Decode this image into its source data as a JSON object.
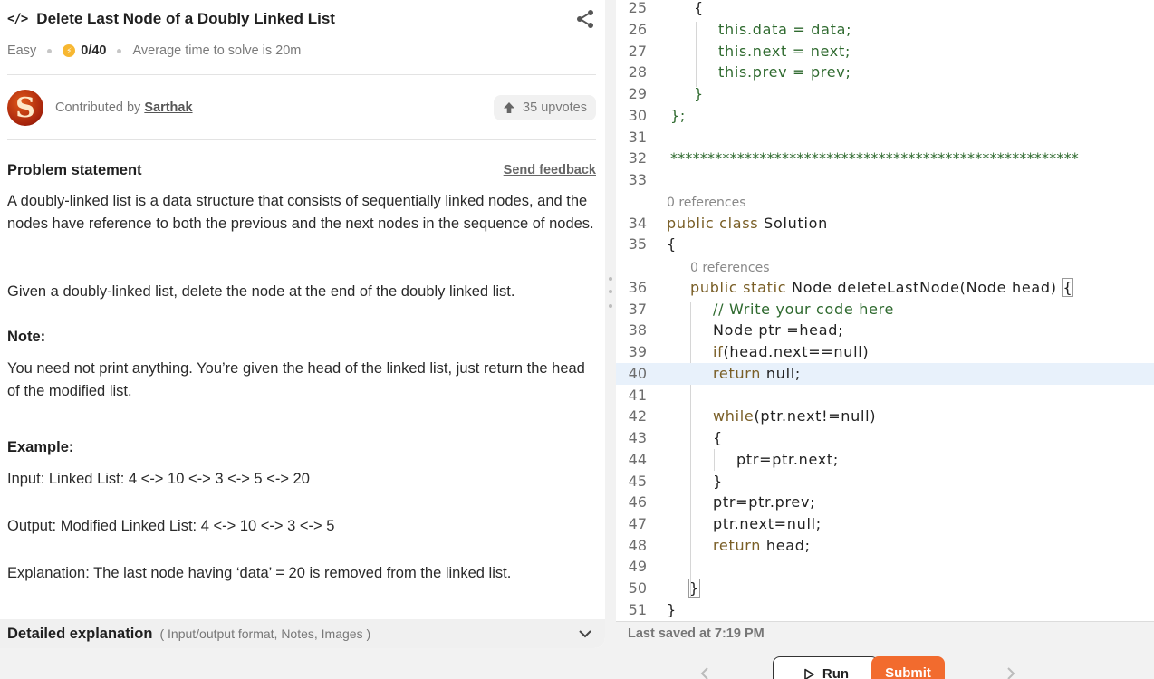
{
  "problem": {
    "title": "Delete Last Node of a Doubly Linked List",
    "difficulty": "Easy",
    "score": "0/40",
    "avg_time": "Average time to solve is 20m",
    "contributed_by_label": "Contributed by",
    "contributor": "Sarthak",
    "avatar_letter": "S",
    "upvotes": "35 upvotes",
    "statement_title": "Problem statement",
    "send_feedback": "Send feedback",
    "paragraphs": [
      "A doubly-linked list is a data structure that consists of sequentially linked nodes, and the nodes have reference to both the previous and the next nodes in the sequence of nodes.",
      "Given a doubly-linked list, delete the node at the end of the doubly linked list."
    ],
    "note_title": "Note:",
    "note_text": "You need not print anything. You’re given the head of the linked list, just return the head of the modified list.",
    "example_title": "Example:",
    "example_input": "Input: Linked List:  4 <-> 10 <-> 3 <-> 5 <-> 20",
    "example_output": "Output: Modified Linked List: 4 <-> 10 <-> 3 <-> 5",
    "example_explanation": "Explanation: The last node having ‘data’ = 20 is removed from the linked list.",
    "detailed_title": "Detailed explanation",
    "detailed_sub": "( Input/output format, Notes, Images )"
  },
  "editor": {
    "line_numbers": [
      "25",
      "26",
      "27",
      "28",
      "29",
      "30",
      "31",
      "32",
      "33",
      "34",
      "35",
      "36",
      "37",
      "38",
      "39",
      "40",
      "41",
      "42",
      "43",
      "44",
      "45",
      "46",
      "47",
      "48",
      "49",
      "50",
      "51"
    ],
    "references_label": "0 references",
    "code": {
      "l25": "{",
      "l26": "this.data = data;",
      "l27": "this.next = next;",
      "l28": "this.prev = prev;",
      "l29": "}",
      "l30": "};",
      "l32": "*******************************************************",
      "l34_kw": "public class",
      "l34_tx": " Solution",
      "l35": "{",
      "l36_kw": "public static",
      "l36_tx": " Node deleteLastNode(Node head) ",
      "l36_brace": "{",
      "l37": "// Write your code here",
      "l38": "Node ptr =head;",
      "l39_kw": "if",
      "l39_tx": "(head.next==null)",
      "l40_kw": "return",
      "l40_tx": " null;",
      "l42_kw": "while",
      "l42_tx": "(ptr.next!=null)",
      "l43": "{",
      "l44": "ptr=ptr.next;",
      "l45": "}",
      "l46": "ptr=ptr.prev;",
      "l47": "ptr.next=null;",
      "l48_kw": "return",
      "l48_tx": " head;",
      "l50": "}",
      "l51": "}"
    },
    "last_saved": "Last saved at 7:19 PM"
  },
  "controls": {
    "run_label": "Run",
    "submit_label": "Submit"
  },
  "colors": {
    "submit": "#f26b2e",
    "keyword": "#795e26",
    "comment": "#2f6a2f",
    "highlight_line": "#e8f1fb"
  }
}
